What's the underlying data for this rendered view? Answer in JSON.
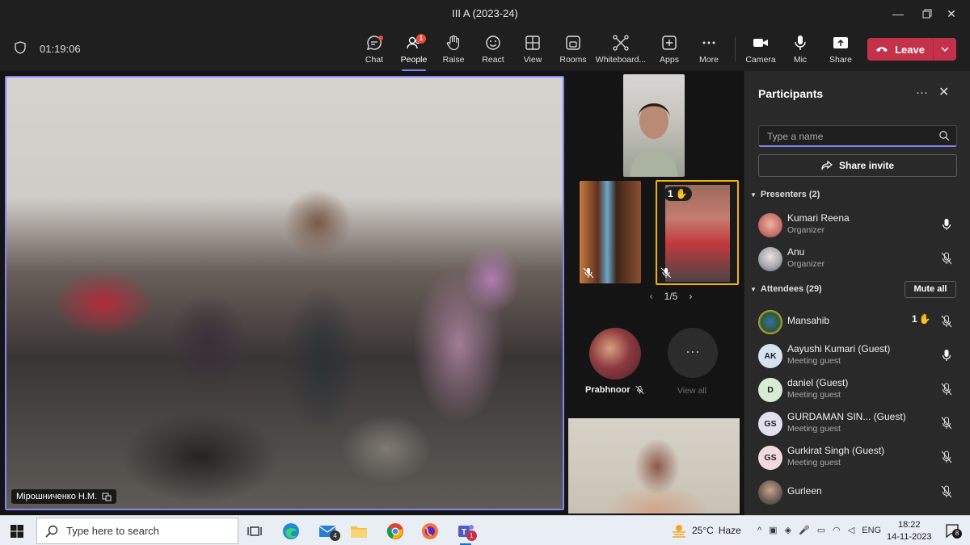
{
  "window": {
    "title": "III A (2023-24)"
  },
  "meeting": {
    "duration": "01:19:06"
  },
  "toolbar": {
    "chat": "Chat",
    "people": "People",
    "people_badge": "1",
    "raise": "Raise",
    "react": "React",
    "view": "View",
    "rooms": "Rooms",
    "whiteboard": "Whiteboard...",
    "apps": "Apps",
    "more": "More",
    "camera": "Camera",
    "mic": "Mic",
    "share": "Share",
    "leave": "Leave"
  },
  "stage": {
    "main_video_name": "Мірошниченко Н.М.",
    "tile_hand_count": "1",
    "pager": "1/5",
    "avatar_tile_name": "Prabhnoor",
    "view_all": "View all"
  },
  "panel": {
    "title": "Participants",
    "search_placeholder": "Type a name",
    "share_invite": "Share invite",
    "presenters_header": "Presenters (2)",
    "attendees_header": "Attendees (29)",
    "mute_all": "Mute all",
    "presenters": [
      {
        "name": "Kumari Reena",
        "role": "Organizer",
        "muted": false
      },
      {
        "name": "Anu",
        "role": "Organizer",
        "muted": true
      }
    ],
    "attendees": [
      {
        "name": "Mansahib",
        "role": "",
        "hand": "1",
        "muted": true
      },
      {
        "name": "Aayushi Kumari (Guest)",
        "role": "Meeting guest",
        "initials": "AK",
        "muted": false
      },
      {
        "name": "daniel (Guest)",
        "role": "Meeting guest",
        "initials": "D",
        "muted": true
      },
      {
        "name": "GURDAMAN SIN... (Guest)",
        "role": "Meeting guest",
        "initials": "GS",
        "muted": true
      },
      {
        "name": "Gurkirat Singh (Guest)",
        "role": "Meeting guest",
        "initials": "GS",
        "muted": true
      },
      {
        "name": "Gurleen",
        "role": "",
        "muted": true
      }
    ]
  },
  "taskbar": {
    "search_placeholder": "Type here to search",
    "mail_badge": "4",
    "teams_badge": "1",
    "weather_temp": "25°C",
    "weather_desc": "Haze",
    "language": "ENG",
    "time": "18:22",
    "date": "14-11-2023",
    "notification_count": "8"
  },
  "colors": {
    "accent": "#7f85f5",
    "leave": "#c4314b",
    "raised_hand": "#f5b300",
    "badge": "#e94b3c"
  }
}
